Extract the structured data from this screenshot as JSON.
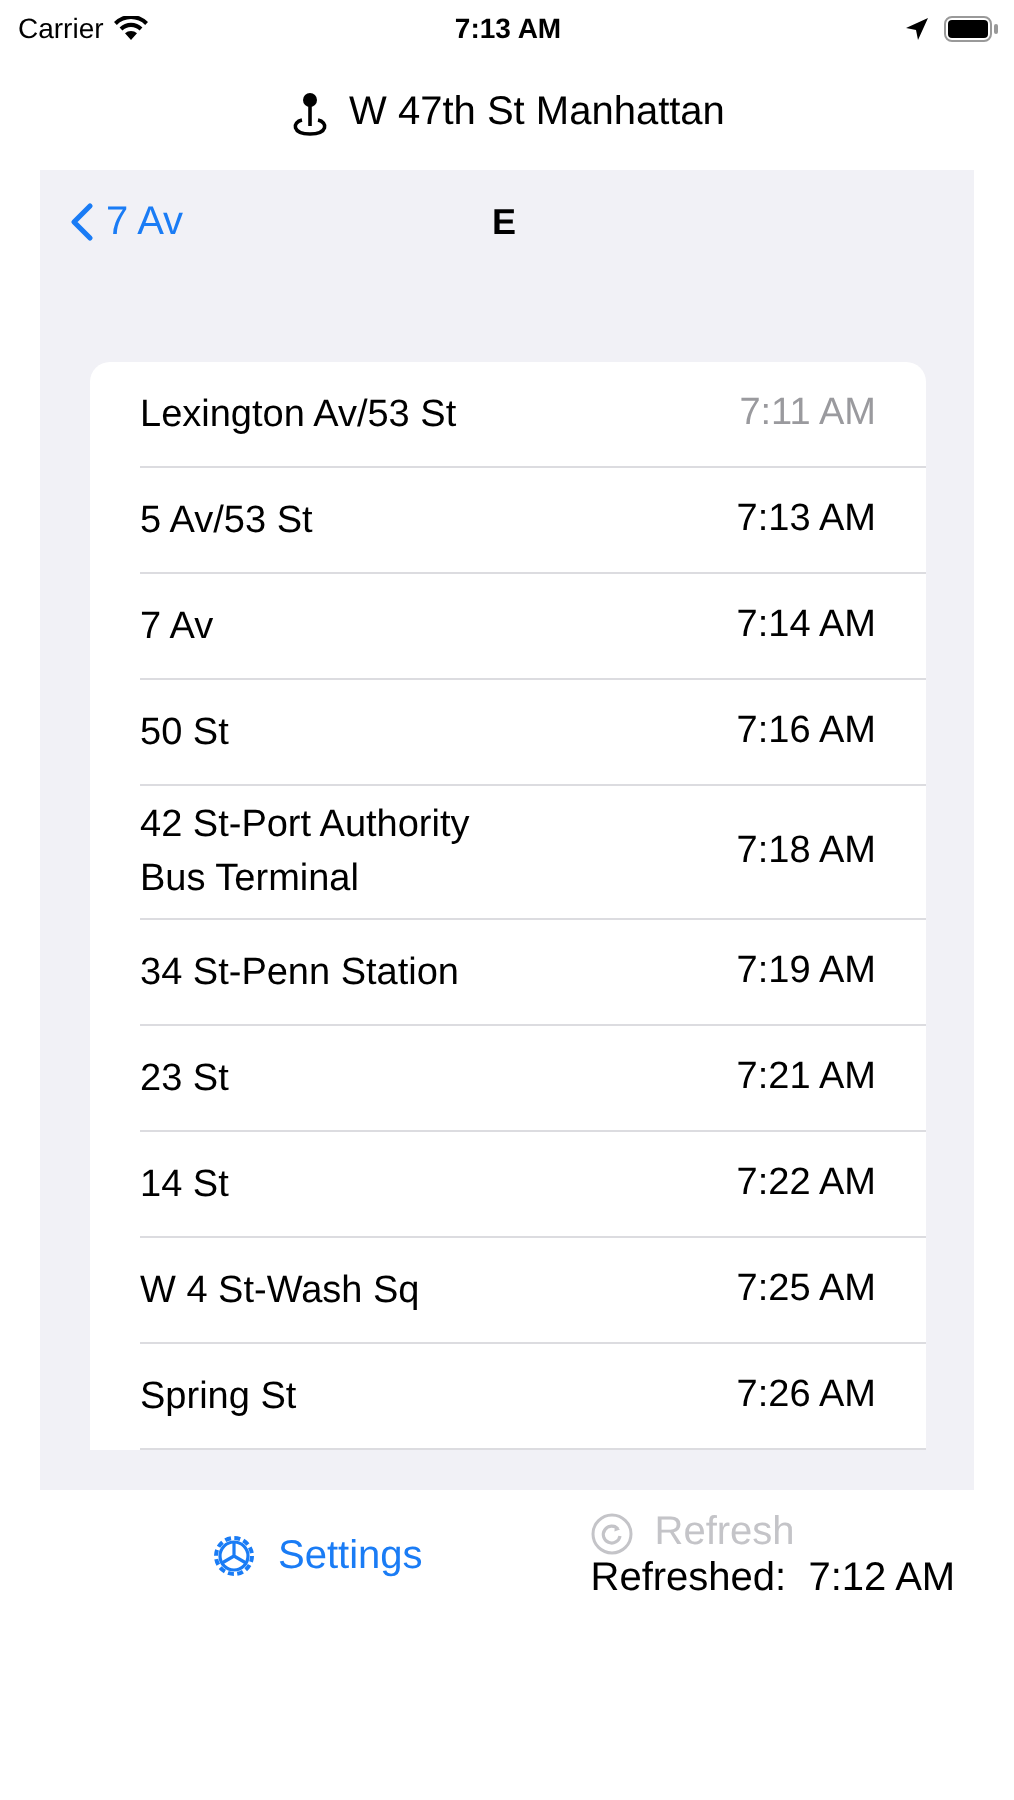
{
  "status_bar": {
    "carrier": "Carrier",
    "time": "7:13 AM"
  },
  "location": {
    "title": "W 47th St Manhattan"
  },
  "nav": {
    "back_label": "7 Av",
    "title": "E"
  },
  "stops": [
    {
      "name": "Lexington Av/53 St",
      "time": "7:11 AM",
      "past": true
    },
    {
      "name": "5 Av/53 St",
      "time": "7:13 AM",
      "past": false
    },
    {
      "name": "7 Av",
      "time": "7:14 AM",
      "past": false
    },
    {
      "name": "50 St",
      "time": "7:16 AM",
      "past": false
    },
    {
      "name": "42 St-Port Authority Bus Terminal",
      "time": "7:18 AM",
      "past": false
    },
    {
      "name": "34 St-Penn Station",
      "time": "7:19 AM",
      "past": false
    },
    {
      "name": "23 St",
      "time": "7:21 AM",
      "past": false
    },
    {
      "name": "14 St",
      "time": "7:22 AM",
      "past": false
    },
    {
      "name": "W 4 St-Wash Sq",
      "time": "7:25 AM",
      "past": false
    },
    {
      "name": "Spring St",
      "time": "7:26 AM",
      "past": false
    }
  ],
  "toolbar": {
    "settings": {
      "label": "Settings",
      "disabled": false
    },
    "refresh": {
      "label": "Refresh",
      "disabled": true
    },
    "refreshed": "Refreshed:  7:12 AM"
  }
}
